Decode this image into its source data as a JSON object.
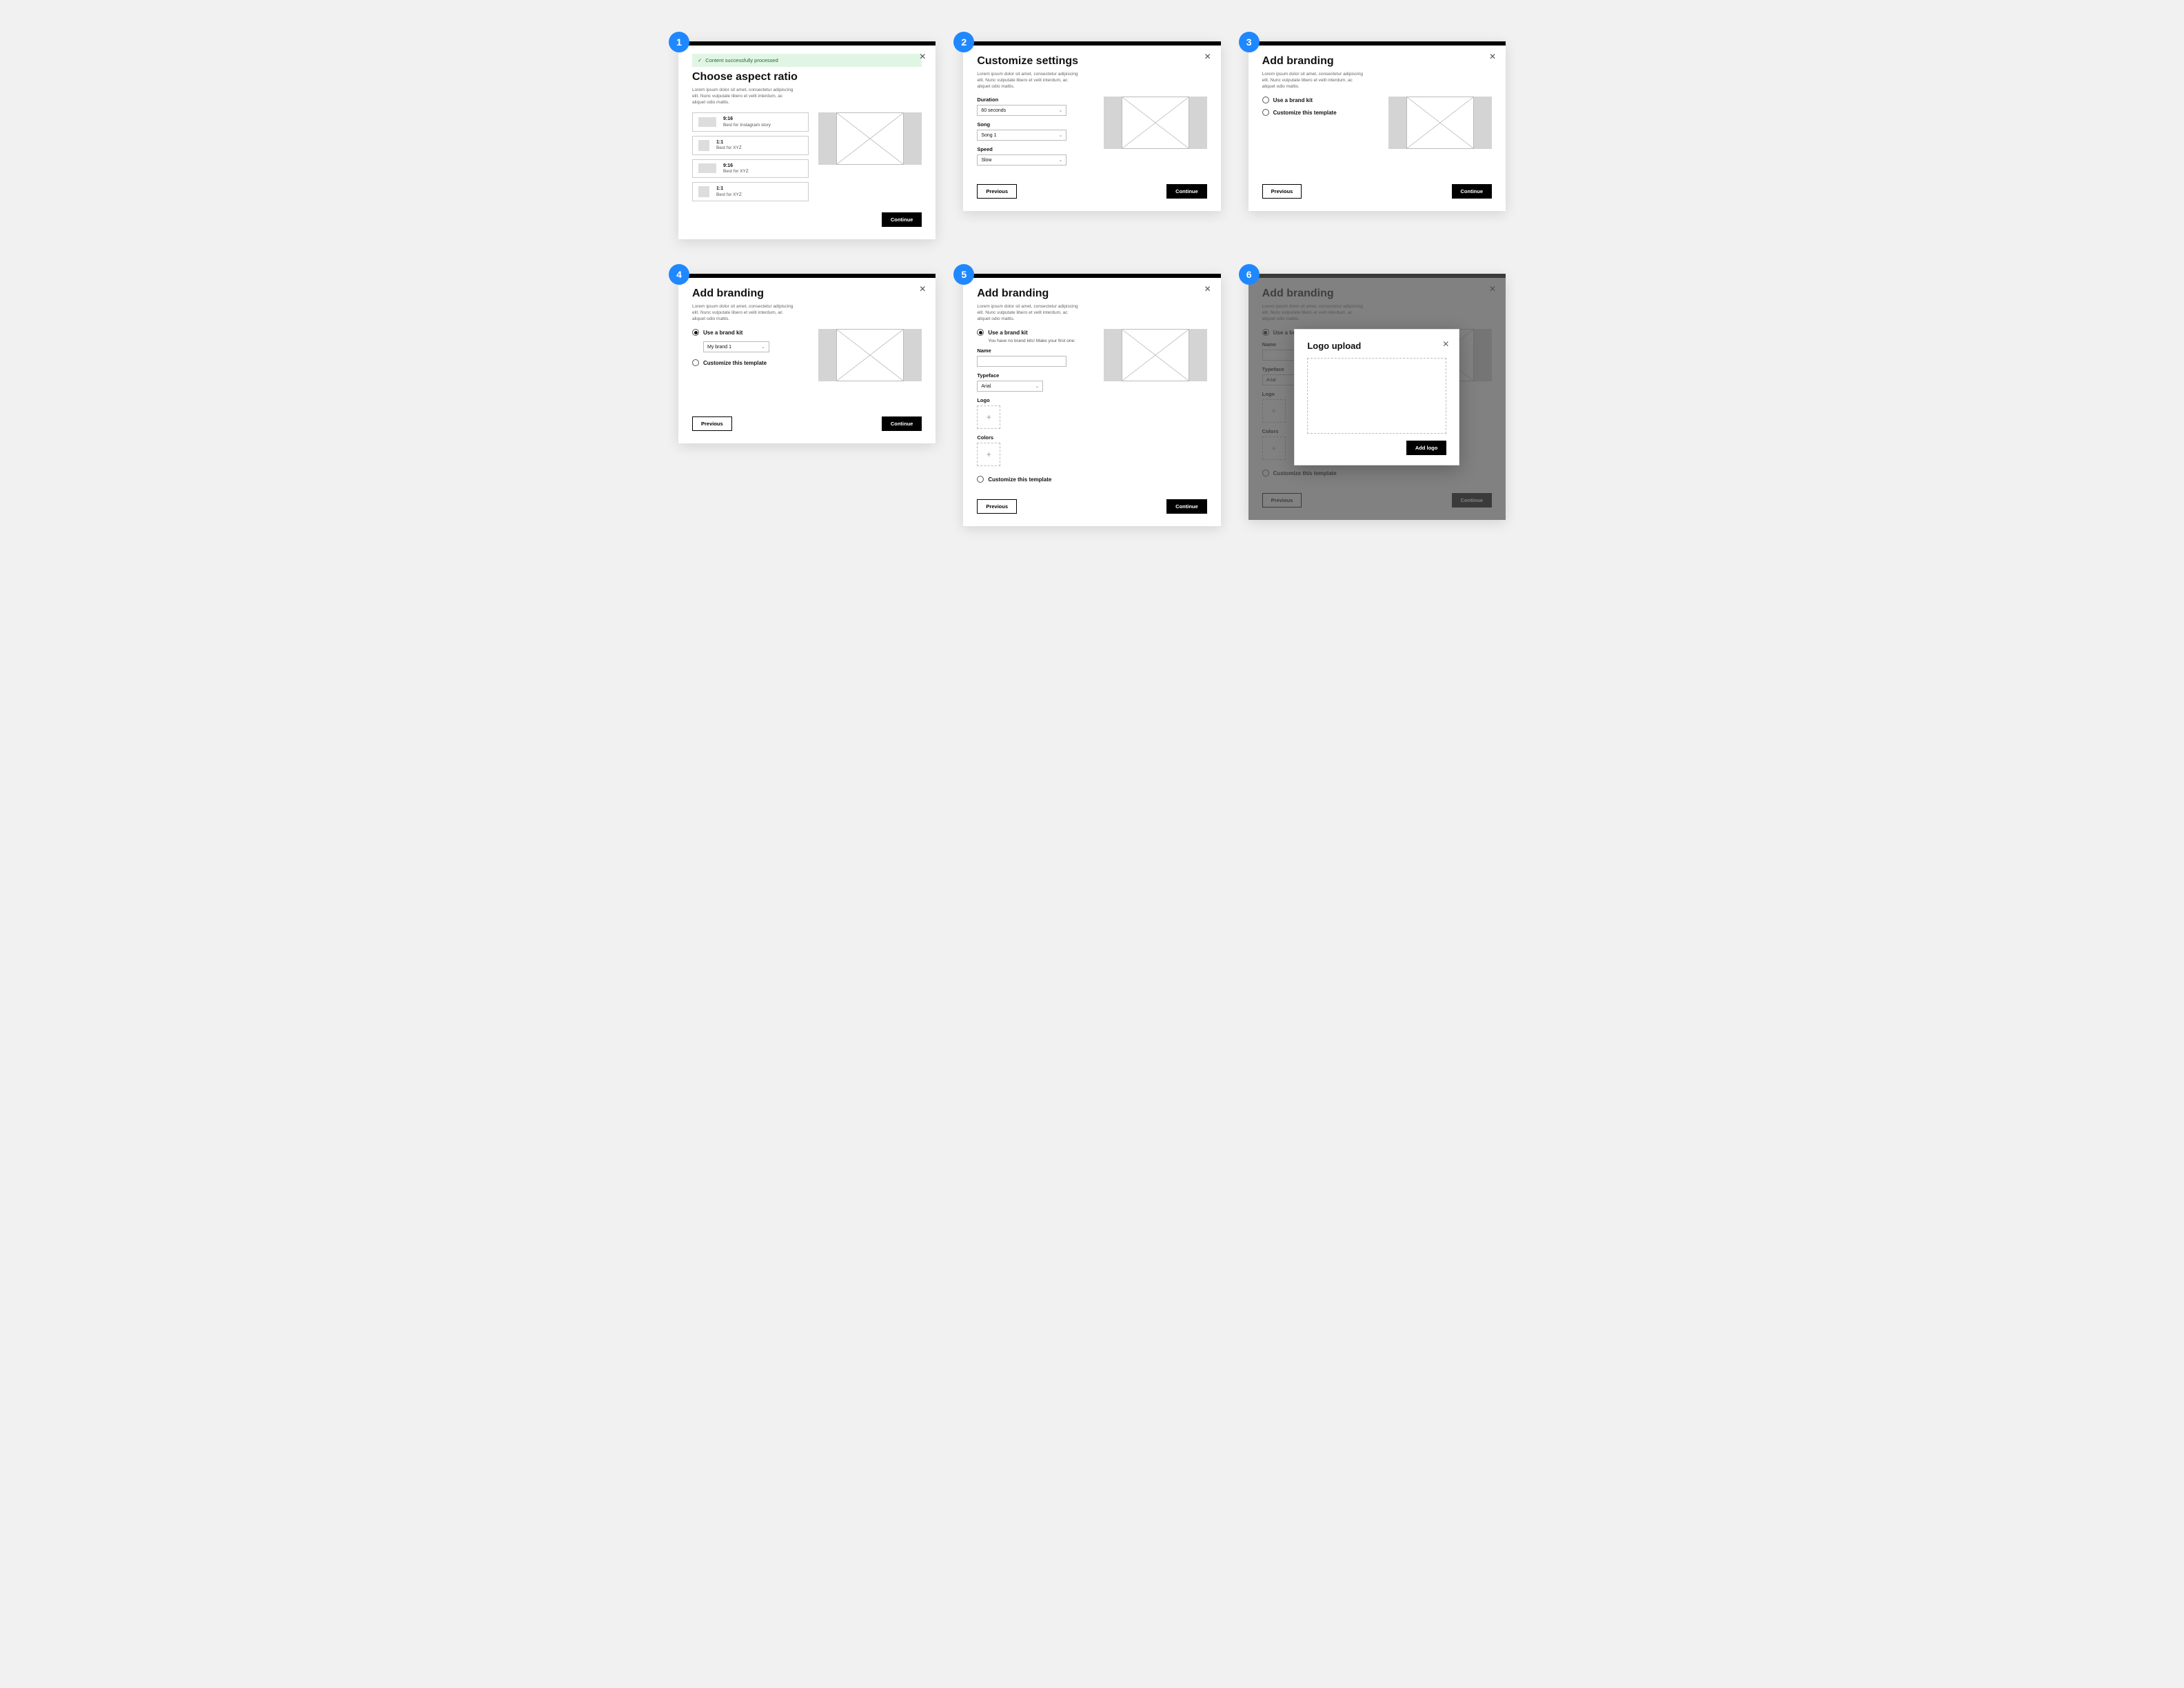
{
  "lorem": "Lorem ipsum dolor sit amet, consectetur adipiscing elit. Nunc vulputate libero et velit interdum, ac aliquet odio mattis.",
  "buttons": {
    "continue": "Continue",
    "previous": "Previous",
    "add_logo": "Add logo"
  },
  "frames": [
    {
      "num": "1",
      "alert": "Content successfully processed",
      "title": "Choose aspect ratio",
      "aspect_options": [
        {
          "ratio": "9:16",
          "desc": "Best for Instagram story",
          "shape": "wide"
        },
        {
          "ratio": "1:1",
          "desc": "Best for XYZ",
          "shape": "sq"
        },
        {
          "ratio": "9:16",
          "desc": "Best for XYZ",
          "shape": "wide"
        },
        {
          "ratio": "1:1",
          "desc": "Best for XYZ",
          "shape": "sq"
        }
      ]
    },
    {
      "num": "2",
      "title": "Customize settings",
      "duration_label": "Duration",
      "duration_value": "60 seconds",
      "song_label": "Song",
      "song_value": "Song 1",
      "speed_label": "Speed",
      "speed_value": "Slow"
    },
    {
      "num": "3",
      "title": "Add branding",
      "opt_use": "Use a brand kit",
      "opt_custom": "Customize this template"
    },
    {
      "num": "4",
      "title": "Add branding",
      "opt_use": "Use a brand kit",
      "brand_select": "My brand 1",
      "opt_custom": "Customize this template"
    },
    {
      "num": "5",
      "title": "Add branding",
      "opt_use": "Use a brand kit",
      "no_kits": "You have no brand kits! Make your first one:",
      "name_label": "Name",
      "typeface_label": "Typeface",
      "typeface_value": "Arial",
      "logo_label": "Logo",
      "colors_label": "Colors",
      "opt_custom": "Customize this template"
    },
    {
      "num": "6",
      "title": "Add branding",
      "opt_use": "Use a brand kit",
      "name_label": "Name",
      "typeface_label": "Typeface",
      "typeface_value": "Arial",
      "logo_label": "Logo",
      "colors_label": "Colors",
      "opt_custom": "Customize this template",
      "modal_title": "Logo upload"
    }
  ]
}
